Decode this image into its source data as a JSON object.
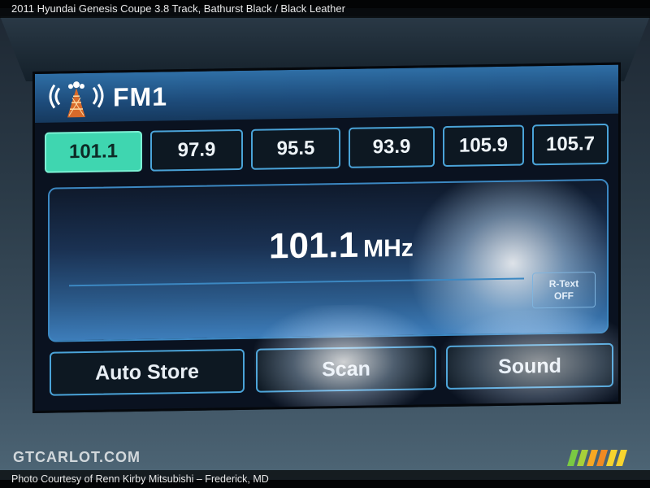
{
  "photo_caption": {
    "top": "2011 Hyundai Genesis Coupe 3.8 Track,  Bathurst Black / Black Leather",
    "bottom": "Photo Courtesy of Renn Kirby Mitsubishi – Frederick, MD"
  },
  "watermark": "GTCARLOT.COM",
  "radio": {
    "band_label": "FM1",
    "presets": [
      {
        "label": "101.1",
        "active": true
      },
      {
        "label": "97.9",
        "active": false
      },
      {
        "label": "95.5",
        "active": false
      },
      {
        "label": "93.9",
        "active": false
      },
      {
        "label": "105.9",
        "active": false
      },
      {
        "label": "105.7",
        "active": false
      }
    ],
    "current_frequency": "101.1",
    "frequency_unit": "MHz",
    "rtext_line1": "R-Text",
    "rtext_line2": "OFF",
    "buttons": {
      "auto_store": "Auto Store",
      "scan": "Scan",
      "sound": "Sound"
    }
  },
  "colors": {
    "active_preset": "#3fd6b0",
    "border_accent": "#4aa3d8",
    "title_bar": "#2f6fa6"
  }
}
